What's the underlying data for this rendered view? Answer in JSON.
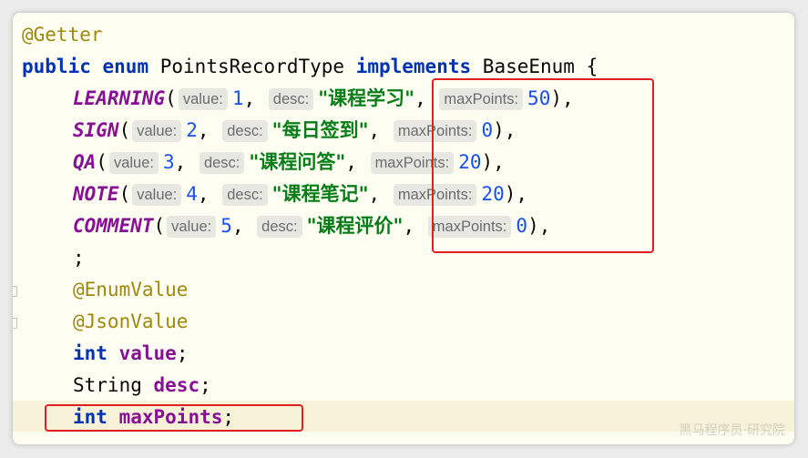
{
  "code": {
    "line1": {
      "annotation": "@Getter"
    },
    "line2": {
      "kw_public": "public",
      "kw_enum": "enum",
      "class_name": "PointsRecordType",
      "kw_implements": "implements",
      "iface": "BaseEnum",
      "brace": "{"
    },
    "entries": [
      {
        "name": "LEARNING",
        "value_hint": "value:",
        "value": "1",
        "desc_hint": "desc:",
        "desc": "\"课程学习\"",
        "max_hint": "maxPoints:",
        "max": "50",
        "end": "),"
      },
      {
        "name": "SIGN",
        "value_hint": "value:",
        "value": "2",
        "desc_hint": "desc:",
        "desc": "\"每日签到\"",
        "max_hint": "maxPoints:",
        "max": "0",
        "end": "),"
      },
      {
        "name": "QA",
        "value_hint": "value:",
        "value": "3",
        "desc_hint": "desc:",
        "desc": "\"课程问答\"",
        "max_hint": "maxPoints:",
        "max": "20",
        "end": "),"
      },
      {
        "name": "NOTE",
        "value_hint": "value:",
        "value": "4",
        "desc_hint": "desc:",
        "desc": "\"课程笔记\"",
        "max_hint": "maxPoints:",
        "max": "20",
        "end": "),"
      },
      {
        "name": "COMMENT",
        "value_hint": "value:",
        "value": "5",
        "desc_hint": "desc:",
        "desc": "\"课程评价\"",
        "max_hint": "maxPoints:",
        "max": "0",
        "end": "),"
      }
    ],
    "semicolon": ";",
    "ann_enum_value": "@EnumValue",
    "ann_json_value": "@JsonValue",
    "field_value": {
      "type": "int",
      "name": "value",
      "end": ";"
    },
    "field_desc": {
      "type": "String",
      "name": "desc",
      "end": ";"
    },
    "field_max": {
      "type": "int",
      "name": "maxPoints",
      "end": ";"
    }
  },
  "watermark": "黑马程序员·研究院",
  "colors": {
    "highlight_box": "#e02020",
    "keyword": "#0033b3",
    "constant": "#871094",
    "string": "#067d17",
    "number": "#1750eb",
    "annotation": "#9e880d"
  }
}
